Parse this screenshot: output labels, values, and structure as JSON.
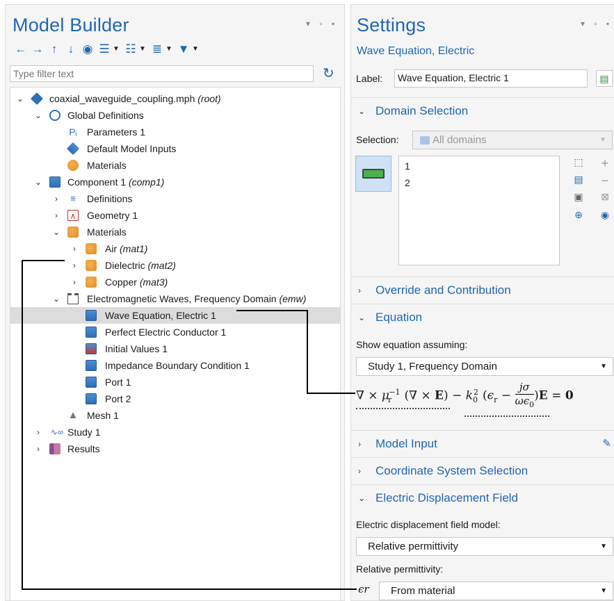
{
  "model_builder": {
    "title": "Model Builder",
    "filter_placeholder": "Type filter text",
    "tree": {
      "root": {
        "name": "coaxial_waveguide_coupling.mph",
        "tag": "(root)"
      },
      "global_definitions": "Global Definitions",
      "parameters": "Parameters 1",
      "default_inputs": "Default Model Inputs",
      "global_materials": "Materials",
      "component": {
        "name": "Component 1",
        "tag": "(comp1)"
      },
      "definitions": "Definitions",
      "geometry": "Geometry 1",
      "materials": "Materials",
      "air": {
        "name": "Air",
        "tag": "(mat1)"
      },
      "dielectric": {
        "name": "Dielectric",
        "tag": "(mat2)"
      },
      "copper": {
        "name": "Copper",
        "tag": "(mat3)"
      },
      "emw": {
        "name": "Electromagnetic Waves, Frequency Domain",
        "tag": "(emw)"
      },
      "wave_eq": "Wave Equation, Electric 1",
      "pec": "Perfect Electric Conductor 1",
      "init": "Initial Values 1",
      "ibc": "Impedance Boundary Condition 1",
      "port1": "Port 1",
      "port2": "Port 2",
      "mesh": "Mesh 1",
      "study": "Study 1",
      "results": "Results"
    }
  },
  "settings": {
    "title": "Settings",
    "subtitle": "Wave Equation, Electric",
    "label_caption": "Label:",
    "label_value": "Wave Equation, Electric 1",
    "domain_selection": {
      "title": "Domain Selection",
      "selection_caption": "Selection:",
      "selection_value": "All domains",
      "items": [
        "1",
        "2"
      ]
    },
    "override": "Override and Contribution",
    "equation": {
      "title": "Equation",
      "show_caption": "Show equation assuming:",
      "study_value": "Study 1, Frequency Domain"
    },
    "model_input": "Model Input",
    "coord_sys": "Coordinate System Selection",
    "edf": {
      "title": "Electric Displacement Field",
      "model_caption": "Electric displacement field model:",
      "model_value": "Relative permittivity",
      "perm_caption": "Relative permittivity:",
      "eps_symbol": "ϵr",
      "perm_value": "From material"
    }
  },
  "colors": {
    "accent": "#2167b1",
    "selected_row": "#dcdcdc"
  }
}
